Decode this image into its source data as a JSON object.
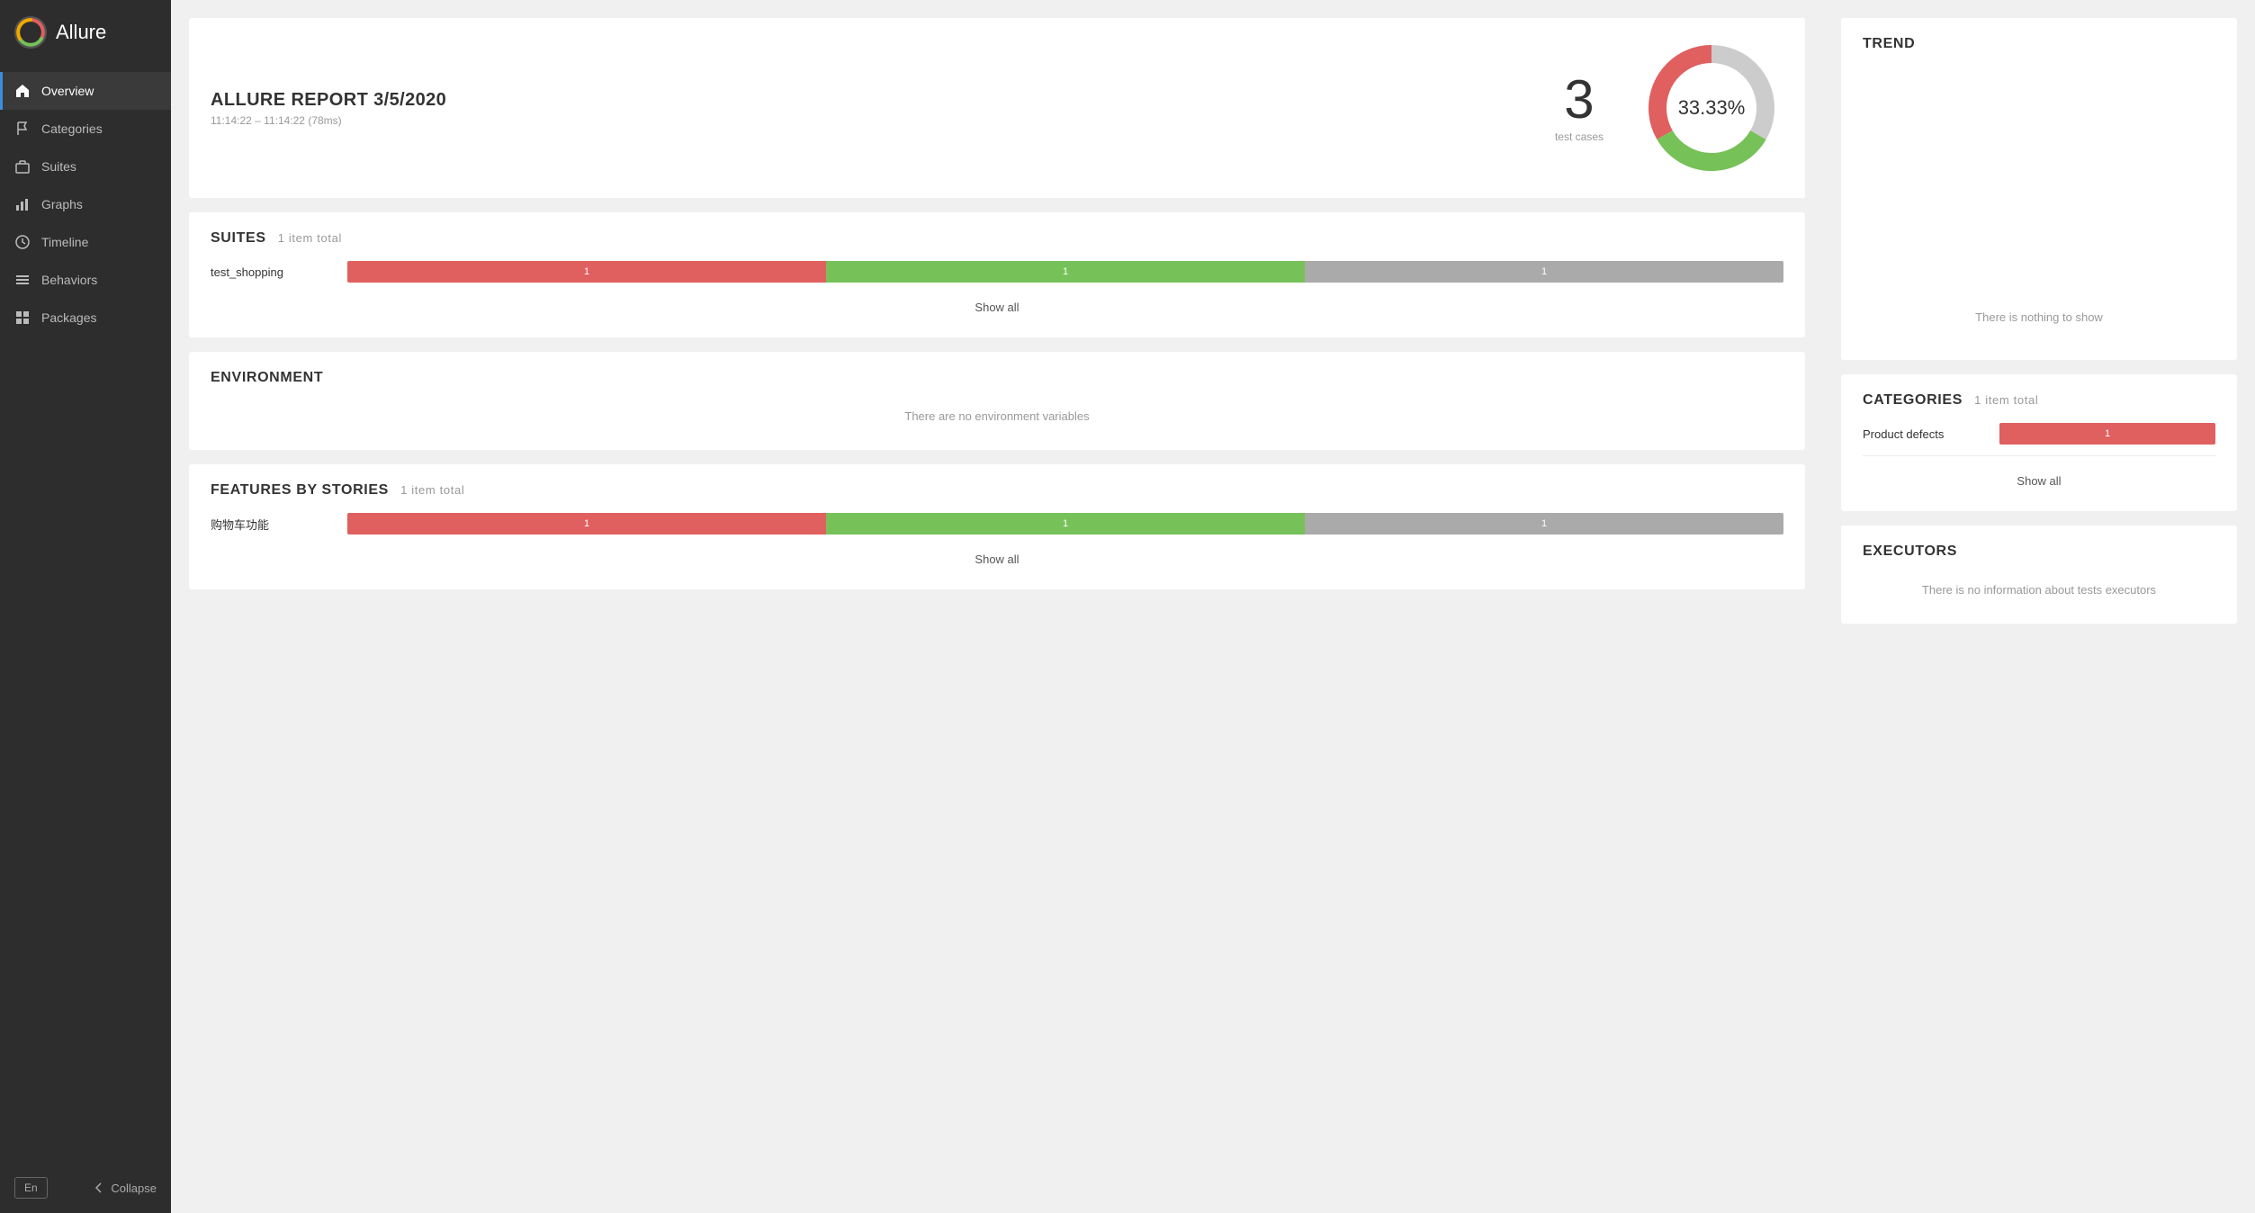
{
  "sidebar": {
    "title": "Allure",
    "nav_items": [
      {
        "id": "overview",
        "label": "Overview",
        "active": true,
        "icon": "home"
      },
      {
        "id": "categories",
        "label": "Categories",
        "active": false,
        "icon": "flag"
      },
      {
        "id": "suites",
        "label": "Suites",
        "active": false,
        "icon": "briefcase"
      },
      {
        "id": "graphs",
        "label": "Graphs",
        "active": false,
        "icon": "bar-chart"
      },
      {
        "id": "timeline",
        "label": "Timeline",
        "active": false,
        "icon": "clock"
      },
      {
        "id": "behaviors",
        "label": "Behaviors",
        "active": false,
        "icon": "list"
      },
      {
        "id": "packages",
        "label": "Packages",
        "active": false,
        "icon": "grid"
      }
    ],
    "lang_button": "En",
    "collapse_label": "Collapse"
  },
  "report": {
    "title": "ALLURE REPORT 3/5/2020",
    "subtitle": "11:14:22 – 11:14:22 (78ms)",
    "test_cases_count": "3",
    "test_cases_label": "test cases",
    "donut_percent": "33.33%",
    "donut_segments": {
      "red_pct": 33.33,
      "green_pct": 33.33,
      "gray_pct": 33.34
    }
  },
  "suites": {
    "title": "SUITES",
    "count_label": "1 item total",
    "items": [
      {
        "name": "test_shopping",
        "red": 1,
        "green": 1,
        "gray": 1
      }
    ],
    "show_all": "Show all"
  },
  "environment": {
    "title": "ENVIRONMENT",
    "empty_msg": "There are no environment variables"
  },
  "features": {
    "title": "FEATURES BY STORIES",
    "count_label": "1 item total",
    "items": [
      {
        "name": "购物车功能",
        "red": 1,
        "green": 1,
        "gray": 1
      }
    ],
    "show_all": "Show all"
  },
  "trend": {
    "title": "TREND",
    "empty_msg": "There is nothing to show"
  },
  "categories": {
    "title": "CATEGORIES",
    "count_label": "1 item total",
    "items": [
      {
        "name": "Product defects",
        "red": 1,
        "green": 0,
        "gray": 0
      }
    ],
    "show_all": "Show all"
  },
  "executors": {
    "title": "EXECUTORS",
    "empty_msg": "There is no information about tests executors"
  }
}
